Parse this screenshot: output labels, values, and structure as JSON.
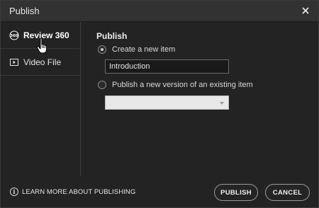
{
  "dialog": {
    "title": "Publish",
    "close_icon": "close-icon"
  },
  "sidebar": {
    "items": [
      {
        "label": "Review 360",
        "icon": "review-360-icon",
        "active": true
      },
      {
        "label": "Video File",
        "icon": "video-file-icon",
        "active": false
      }
    ]
  },
  "main": {
    "section_title": "Publish",
    "option_new": "Create a new item",
    "option_existing": "Publish a new version of an existing item",
    "item_name_value": "Introduction",
    "existing_item_selected": ""
  },
  "footer": {
    "learn_more": "LEARN MORE ABOUT PUBLISHING",
    "publish_label": "PUBLISH",
    "cancel_label": "CANCEL"
  },
  "colors": {
    "background": "#232323",
    "titlebar": "#323232",
    "text": "#e6e6e6"
  }
}
